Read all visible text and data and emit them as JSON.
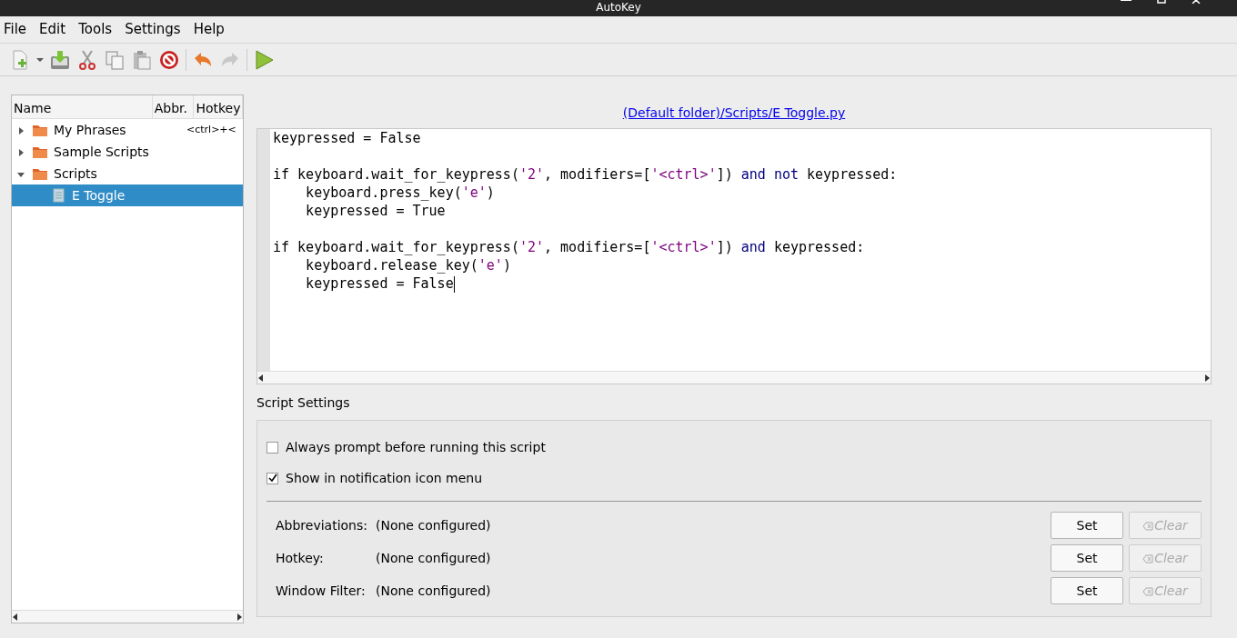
{
  "window": {
    "title": "AutoKey"
  },
  "menu": [
    "File",
    "Edit",
    "Tools",
    "Settings",
    "Help"
  ],
  "tree": {
    "columns": [
      "Name",
      "Abbr.",
      "Hotkey"
    ],
    "items": [
      {
        "label": "My Phrases",
        "kind": "folder",
        "hotkey": "<ctrl>+<",
        "expanded": false,
        "selected": false
      },
      {
        "label": "Sample Scripts",
        "kind": "folder",
        "expanded": false,
        "selected": false
      },
      {
        "label": "Scripts",
        "kind": "folder",
        "expanded": true,
        "selected": false,
        "children": [
          {
            "label": "E Toggle",
            "kind": "script",
            "selected": true
          }
        ]
      }
    ]
  },
  "editor": {
    "path": "(Default folder)/Scripts/E Toggle.py",
    "lines": [
      [
        {
          "kind": "plain",
          "text": "keypressed = False"
        }
      ],
      [
        {
          "kind": "blank"
        },
        {
          "kind": "plain",
          "text": "if keyboard.wait_for_keypress("
        },
        {
          "kind": "string",
          "text": "'2'"
        },
        {
          "kind": "plain",
          "text": ", modifiers=["
        },
        {
          "kind": "string",
          "text": "'<ctrl>'"
        },
        {
          "kind": "plain",
          "text": "]) "
        },
        {
          "kind": "keyword",
          "text": "and not"
        },
        {
          "kind": "plain",
          "text": " keypressed:"
        }
      ],
      [
        {
          "kind": "plain",
          "text": "    keyboard.press_key("
        },
        {
          "kind": "string",
          "text": "'e'"
        },
        {
          "kind": "plain",
          "text": ")"
        }
      ],
      [
        {
          "kind": "plain",
          "text": "    keypressed = True"
        }
      ],
      [
        {
          "kind": "blank"
        },
        {
          "kind": "plain",
          "text": "if keyboard.wait_for_keypress("
        },
        {
          "kind": "string",
          "text": "'2'"
        },
        {
          "kind": "plain",
          "text": ", modifiers=["
        },
        {
          "kind": "string",
          "text": "'<ctrl>'"
        },
        {
          "kind": "plain",
          "text": "]) "
        },
        {
          "kind": "keyword",
          "text": "and"
        },
        {
          "kind": "plain",
          "text": " keypressed:"
        }
      ],
      [
        {
          "kind": "plain",
          "text": "    keyboard.release_key("
        },
        {
          "kind": "string",
          "text": "'e'"
        },
        {
          "kind": "plain",
          "text": ")"
        }
      ],
      [
        {
          "kind": "plain",
          "text": "    keypressed = False"
        }
      ]
    ]
  },
  "settings": {
    "title": "Script Settings",
    "options": [
      {
        "label": "Always prompt before running this script",
        "checked": false
      },
      {
        "label": "Show in notification icon menu",
        "checked": true
      }
    ],
    "rows": [
      {
        "label": "Abbreviations:",
        "value": "(None configured)",
        "set": "Set",
        "clear": "Clear",
        "clear_disabled": true
      },
      {
        "label": "Hotkey:",
        "value": "(None configured)",
        "set": "Set",
        "clear": "Clear",
        "clear_disabled": true
      },
      {
        "label": "Window Filter:",
        "value": "(None configured)",
        "set": "Set",
        "clear": "Clear",
        "clear_disabled": true
      }
    ]
  }
}
